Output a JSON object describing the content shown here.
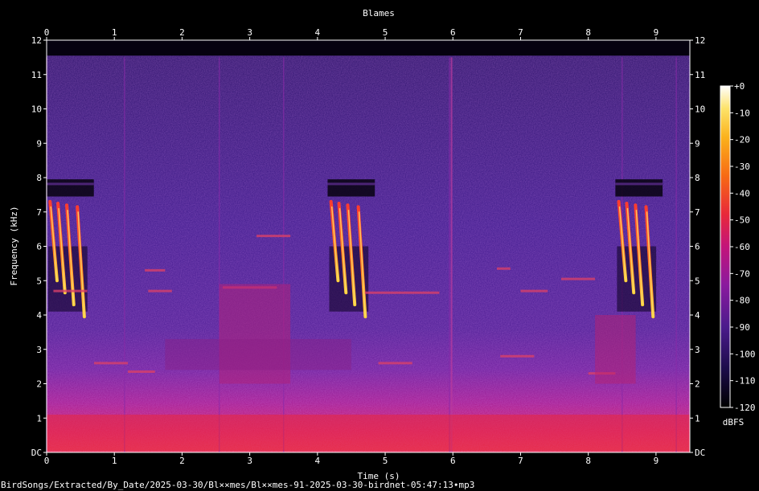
{
  "chart_data": {
    "type": "heatmap",
    "title": "Blames",
    "xlabel": "Time (s)",
    "ylabel": "Frequency (kHz)",
    "xlim": [
      0,
      9.5
    ],
    "ylim": [
      0,
      12
    ],
    "x_ticks": [
      "0",
      "1",
      "2",
      "3",
      "4",
      "5",
      "6",
      "7",
      "8",
      "9"
    ],
    "y_ticks": [
      "DC",
      "1",
      "2",
      "3",
      "4",
      "5",
      "6",
      "7",
      "8",
      "9",
      "10",
      "11",
      "12"
    ],
    "colorbar": {
      "label": "dBFS",
      "range": [
        -120,
        0
      ],
      "ticks": [
        "+0",
        "-10",
        "-20",
        "-30",
        "-40",
        "-50",
        "-60",
        "-70",
        "-80",
        "-90",
        "-100",
        "-110",
        "-120"
      ],
      "colors": [
        "#000000",
        "#1c0c4a",
        "#4b1b8c",
        "#8a1a9e",
        "#c3147a",
        "#e8283a",
        "#f76a14",
        "#fbb21c",
        "#fde36a",
        "#ffffff"
      ]
    },
    "song_phrases": [
      {
        "start": 0.0,
        "end": 0.65,
        "freq_high": 7.3,
        "freq_low": 4.1
      },
      {
        "start": 4.15,
        "end": 4.8,
        "freq_high": 7.3,
        "freq_low": 4.1
      },
      {
        "start": 8.4,
        "end": 9.05,
        "freq_high": 7.3,
        "freq_low": 4.1
      }
    ]
  },
  "footer": {
    "path": "BirdSongs/Extracted/By_Date/2025-03-30/Bl××mes/Bl××mes-91-2025-03-30-birdnet-05:47:13∙mp3"
  }
}
